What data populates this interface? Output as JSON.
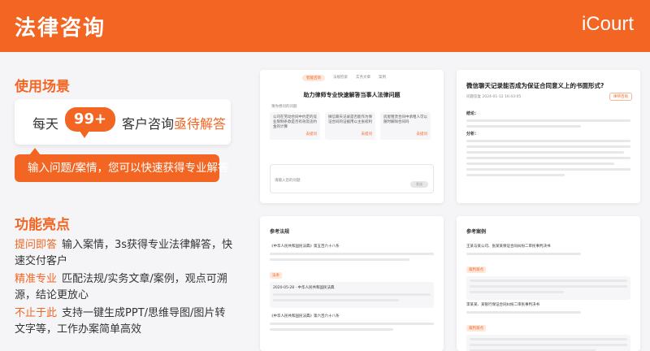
{
  "header": {
    "title": "法律咨询",
    "logo": "iCourt"
  },
  "colors": {
    "accent": "#f26522",
    "background": "#f5f5f7"
  },
  "usage": {
    "title": "使用场景",
    "stat_prefix": "每天",
    "stat_number": "99+",
    "stat_suffix_plain": "客户咨询",
    "stat_suffix_highlight": "亟待解答",
    "banner": "输入问题/案情，您可以快速获得专业解答"
  },
  "features": {
    "title": "功能亮点",
    "items": [
      {
        "keyword": "提问即答",
        "text": "输入案情，3s获得专业法律解答，快速交付客户"
      },
      {
        "keyword": "精准专业",
        "text": "匹配法规/实务文章/案例，观点可溯源，结论更放心"
      },
      {
        "keyword": "不止于此",
        "text": "支持一键生成PPT/思维导图/图片转文字等，工作办案简单高效"
      }
    ]
  },
  "screenshots": {
    "chat": {
      "tabs": [
        "智能咨询",
        "法规检索",
        "实务文章",
        "案例"
      ],
      "title": "助力律师专业快速解答当事人法律问题",
      "hint": "猜你想问的问题",
      "cards": [
        "公司在劳动合同中约定的竞业限制条款是否有效及违约金的计算",
        "微信聊天记录是否能作为保证合同的证据用以主张权利",
        "房屋租赁合同中承租人可以随时解除合同吗"
      ],
      "card_action": "去提问",
      "input_placeholder": "请输入您的问题",
      "send_label": "发送"
    },
    "answer": {
      "title": "微信聊天记录能否成为保证合同意义上的书面形式?",
      "meta": "问题答复  2024-01-12 16:43:05",
      "badge": "律师咨询",
      "conclusion_label": "结论：",
      "analysis_label": "分析："
    },
    "regs": {
      "heading": "参考法规",
      "item1": "《中华人民共和国民法典》第五百六十八条",
      "chip": "法条",
      "item1_sub": "2020-05-28 · 中华人民共和国民法典",
      "item2": "《中华人民共和国民法典》第六百六十八条"
    },
    "cases": {
      "heading": "参考案例",
      "case1": "王某与某公司、张某某保证合同纠纷二审民事判决书",
      "case1_chip": "裁判观点",
      "case2": "李某某、某银行保证合同纠纷二审民事判决书",
      "case2_chip": "裁判观点"
    }
  }
}
